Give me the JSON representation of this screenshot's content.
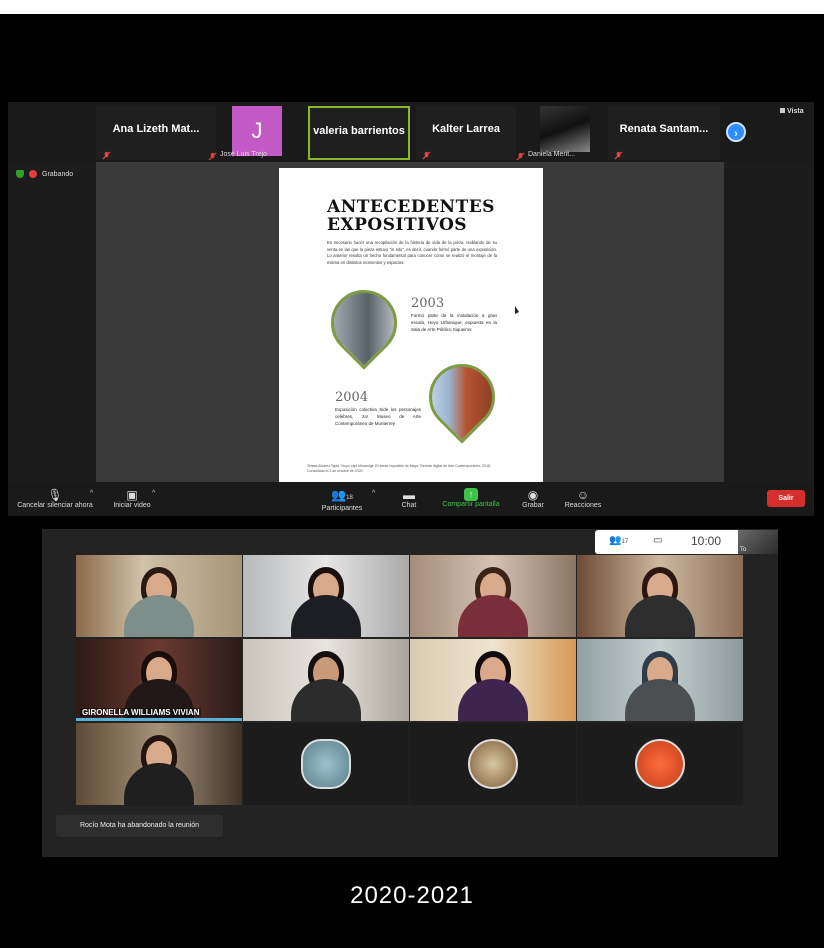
{
  "top_meeting": {
    "participants_strip": [
      {
        "name": "Ana Lizeth Mat...",
        "muted": true
      },
      {
        "name": "José Luis Trejo",
        "initial": "J",
        "muted": true
      },
      {
        "name": "valeria barrientos",
        "active": true
      },
      {
        "name": "Kalter Larrea",
        "muted": true
      },
      {
        "name": "Daniela Merit...",
        "muted": true
      },
      {
        "name": "Renata Santam...",
        "muted": true
      }
    ],
    "next_icon": "chevron-right-icon",
    "view_label": "Vista",
    "recording_label": "Grabando",
    "slide": {
      "title_line1": "ANTECEDENTES",
      "title_line2": "EXPOSITIVOS",
      "intro": "Es necesario hacer una recopilación de la historia de vida de la pieza. Hablando de su venta en las que la pieza estuvo \"in situ\", es decir, cuando formó parte de una exposición. Lo anterior resulta un hecho fundamental para conocer cómo se realizó el montaje de la misma en distintos momentos y espacios.",
      "year1": "2003",
      "text1": "Formó parte de la instalación a gran escala, Hoyo Urbanique, expuesta en la Sala de Arte Público Siqueiros",
      "year2": "2004",
      "text2": "Exposición colectiva Side los personajes celebres, 2o! Museo de Arte Contemporáneo de Monterrey",
      "footnote": "Teresa Alvarez Tapia \"Hoyo Lapi Mnramige 20 Ideas imposible de Mays\" Revista digital de Arte Contemporáneo, 2018. Consultado el 3 de octubre de 2020."
    },
    "toolbar": {
      "mute": "Cancelar silenciar ahora",
      "video": "Iniciar video",
      "participants": "Participantes",
      "participants_count": "18",
      "chat": "Chat",
      "share": "Compartir pantalla",
      "record": "Grabar",
      "reactions": "Reacciones",
      "leave": "Salir"
    }
  },
  "bottom_meeting": {
    "mini_bar": {
      "participants_count": "17",
      "time": "10:00",
      "self_label": "To"
    },
    "gallery": [
      {
        "name": ""
      },
      {
        "name": ""
      },
      {
        "name": ""
      },
      {
        "name": ""
      },
      {
        "name": "GIRONELLA WILLIAMS VIVIAN"
      },
      {
        "name": ""
      },
      {
        "name": ""
      },
      {
        "name": ""
      },
      {
        "name": ""
      }
    ],
    "toast": "Rocío Mota ha abandonado la reunión"
  },
  "caption": "2020-2021",
  "colors": {
    "accent_green": "#3ec24a",
    "leave_red": "#d62d2d",
    "zoom_blue": "#2d8cff",
    "active_border": "#8bb82a"
  }
}
